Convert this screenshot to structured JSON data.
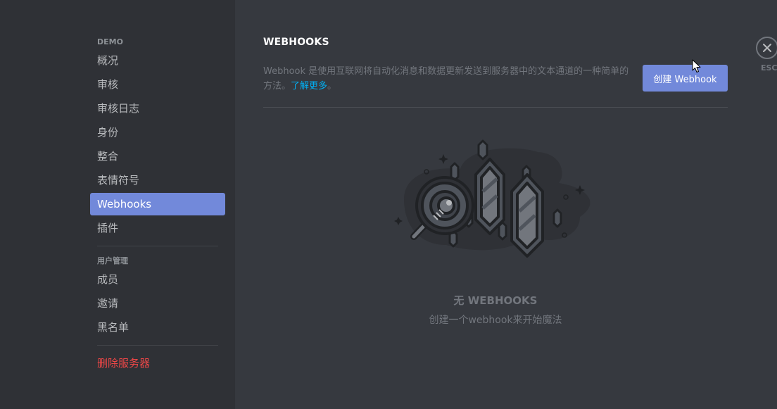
{
  "sidebar": {
    "server_header": "DEMO",
    "server_items": [
      {
        "label": "概况"
      },
      {
        "label": "审核"
      },
      {
        "label": "审核日志"
      },
      {
        "label": "身份"
      },
      {
        "label": "整合"
      },
      {
        "label": "表情符号"
      },
      {
        "label": "Webhooks",
        "selected": true
      },
      {
        "label": "插件"
      }
    ],
    "user_header": "用户管理",
    "user_items": [
      {
        "label": "成员"
      },
      {
        "label": "邀请"
      },
      {
        "label": "黑名单"
      }
    ],
    "delete_label": "删除服务器"
  },
  "main": {
    "title": "WEBHOOKS",
    "description": "Webhook 是使用互联网将自动化消息和数据更新发送到服务器中的文本通道的一种简单的方法。",
    "learn_more": "了解更多",
    "description_end": "。",
    "create_button": "创建 Webhook",
    "empty_title": "无 WEBHOOKS",
    "empty_subtitle": "创建一个webhook来开始魔法"
  },
  "close": {
    "icon": "close-icon",
    "label": "ESC"
  },
  "colors": {
    "accent": "#7289da",
    "danger": "#f04747",
    "link": "#00b0f4",
    "sidebar_bg": "#2f3136",
    "content_bg": "#36393f"
  }
}
